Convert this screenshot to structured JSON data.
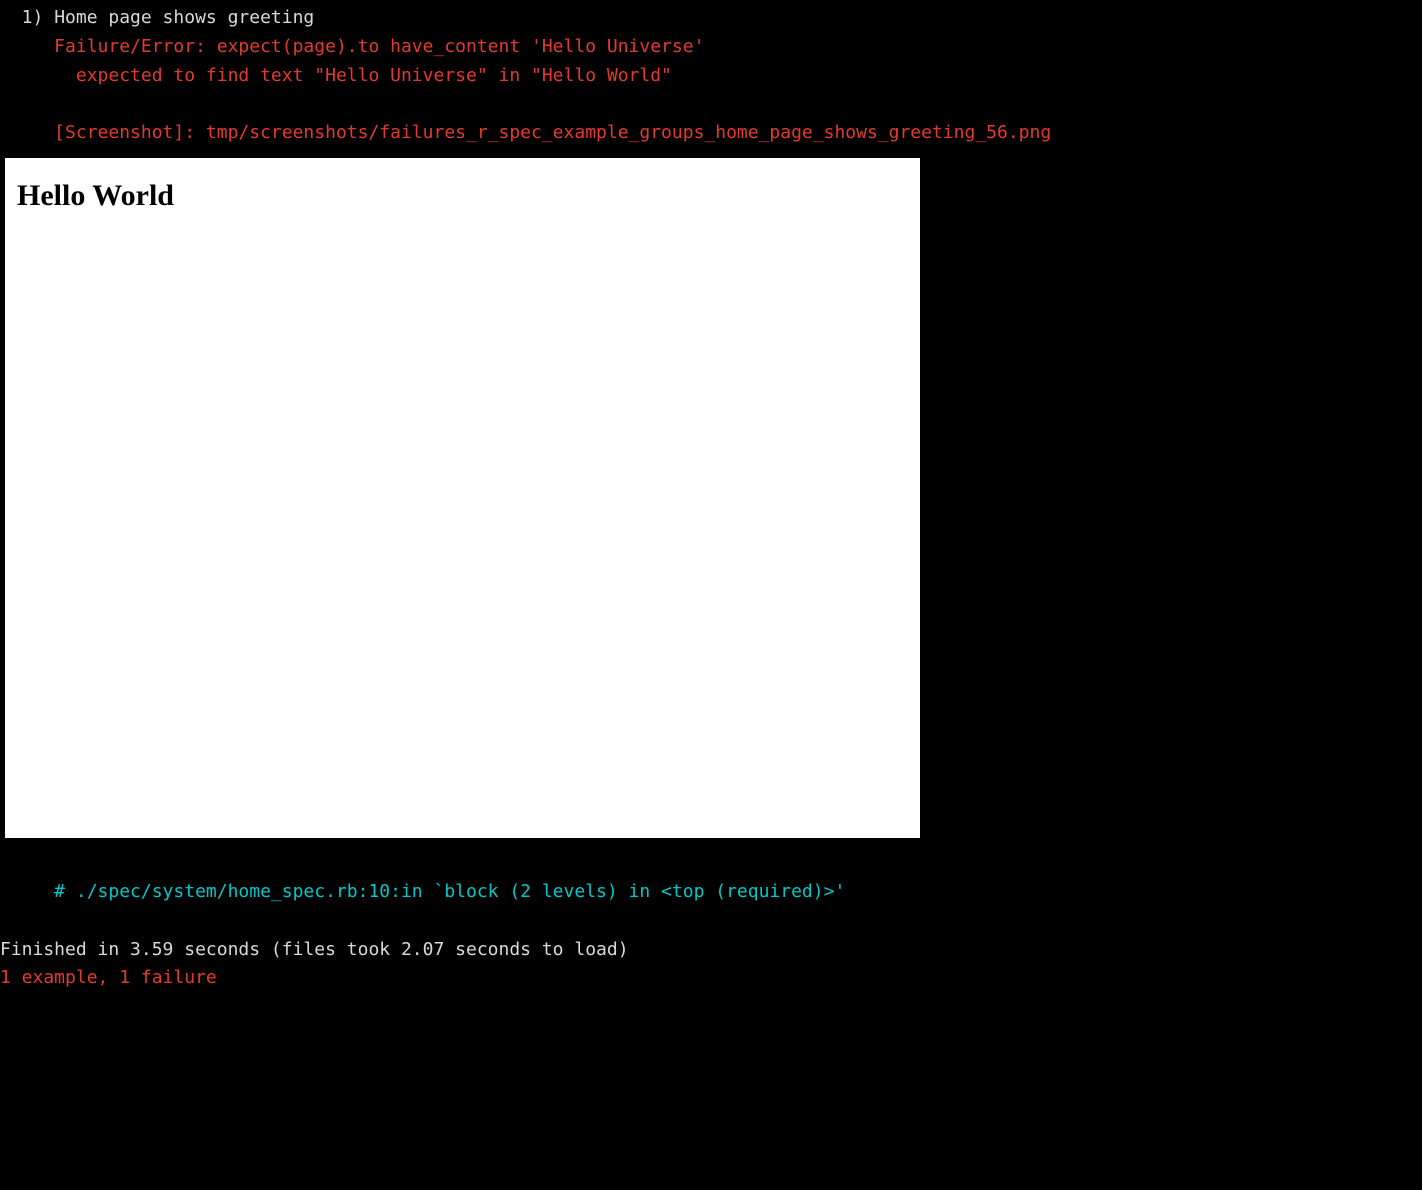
{
  "test": {
    "index_prefix": "  1) ",
    "name": "Home page shows greeting",
    "failure_line": "     Failure/Error: expect(page).to have_content 'Hello Universe'",
    "expected_line": "       expected to find text \"Hello Universe\" in \"Hello World\"",
    "screenshot_line": "     [Screenshot]: tmp/screenshots/failures_r_spec_example_groups_home_page_shows_greeting_56.png"
  },
  "screenshot": {
    "heading": "Hello World"
  },
  "backtrace": {
    "line": "     # ./spec/system/home_spec.rb:10:in `block (2 levels) in <top (required)>'"
  },
  "summary": {
    "finished_line": "Finished in 3.59 seconds (files took 2.07 seconds to load)",
    "result_line": "1 example, 1 failure"
  }
}
